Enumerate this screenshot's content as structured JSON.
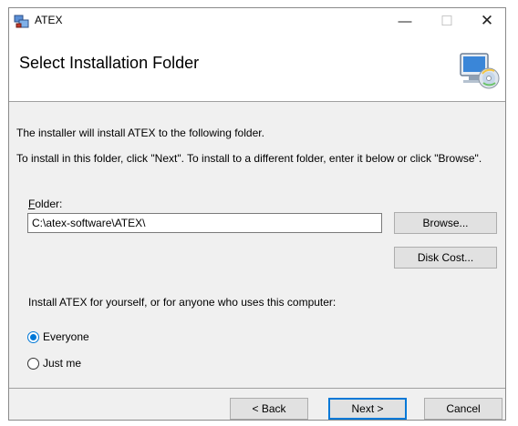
{
  "window": {
    "title": "ATEX",
    "minimize_glyph": "—",
    "maximize_glyph": "☐",
    "close_glyph": "✕"
  },
  "banner": {
    "heading": "Select Installation Folder",
    "graphic_icon": "computer-disc-icon"
  },
  "body": {
    "line1": "The installer will install ATEX to the following folder.",
    "line2": "To install in this folder, click \"Next\". To install to a different folder, enter it below or click \"Browse\".",
    "folder_label_accel": "F",
    "folder_label_rest": "older:",
    "folder_value": "C:\\atex-software\\ATEX\\",
    "browse_label": "Browse...",
    "disk_cost_label": "Disk Cost...",
    "install_for_label": "Install ATEX for yourself, or for anyone who uses this computer:",
    "radio_everyone": "Everyone",
    "radio_justme": "Just me",
    "selected_option": "Everyone"
  },
  "footer": {
    "back_label": "< Back",
    "next_label": "Next >",
    "cancel_label": "Cancel"
  },
  "colors": {
    "accent": "#0078d7",
    "dialog_bg": "#f0f0f0",
    "button_bg": "#e1e1e1"
  }
}
